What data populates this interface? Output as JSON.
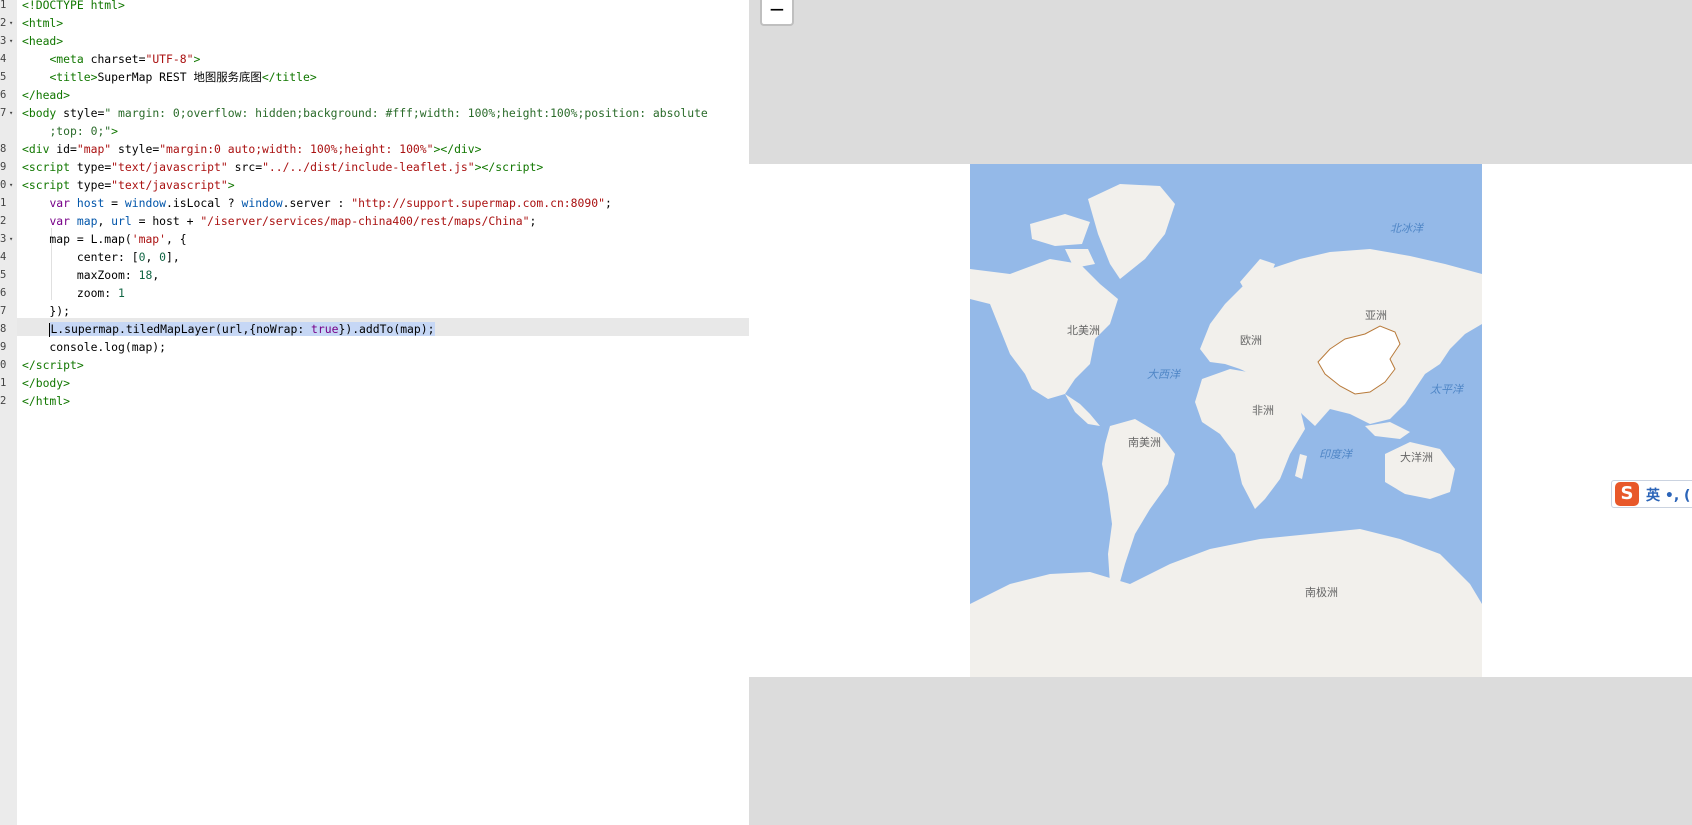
{
  "editor": {
    "lines": [
      {
        "n": "1",
        "fold": "",
        "html": "<span class='tg'>&lt;!DOCTYPE html&gt;</span>"
      },
      {
        "n": "2",
        "fold": "▾",
        "html": "<span class='tg'>&lt;html&gt;</span>"
      },
      {
        "n": "3",
        "fold": "▾",
        "html": "<span class='tg'>&lt;head&gt;</span>"
      },
      {
        "n": "4",
        "fold": "",
        "html": "    <span class='tg'>&lt;meta</span> <span class='at'>charset</span>=<span class='st'>\"UTF-8\"</span><span class='tg'>&gt;</span>"
      },
      {
        "n": "5",
        "fold": "",
        "html": "    <span class='tg'>&lt;title&gt;</span>SuperMap REST 地图服务底图<span class='tg'>&lt;/title&gt;</span>"
      },
      {
        "n": "6",
        "fold": "",
        "html": "<span class='tg'>&lt;/head&gt;</span>"
      },
      {
        "n": "7",
        "fold": "▾",
        "html": "<span class='tg'>&lt;body</span> <span class='at'>style</span>=<span class='gr'>\" margin: 0;overflow: hidden;background: #fff;width: 100%;height:100%;position: absolute</span>"
      },
      {
        "n": "",
        "fold": "",
        "html": "    <span class='gr'>;top: 0;\"</span><span class='tg'>&gt;</span>"
      },
      {
        "n": "8",
        "fold": "",
        "html": "<span class='tg'>&lt;div</span> <span class='at'>id</span>=<span class='st'>\"map\"</span> <span class='at'>style</span>=<span class='st'>\"margin:0 auto;width: 100%;height: 100%\"</span><span class='tg'>&gt;&lt;/div&gt;</span>"
      },
      {
        "n": "9",
        "fold": "",
        "html": "<span class='tg'>&lt;script</span> <span class='at'>type</span>=<span class='st'>\"text/javascript\"</span> <span class='at'>src</span>=<span class='st'>\"../../dist/include-leaflet.js\"</span><span class='tg'>&gt;&lt;/script&gt;</span>"
      },
      {
        "n": "0",
        "fold": "▾",
        "html": "<span class='tg'>&lt;script</span> <span class='at'>type</span>=<span class='st'>\"text/javascript\"</span><span class='tg'>&gt;</span>"
      },
      {
        "n": "1",
        "fold": "",
        "html": "    <span class='kw'>var</span> <span class='vr'>host</span> = <span class='vr'>window</span>.isLocal ? <span class='vr'>window</span>.server : <span class='st'>\"http://support.supermap.com.cn:8090\"</span>;"
      },
      {
        "n": "2",
        "fold": "",
        "html": "    <span class='kw'>var</span> <span class='vr'>map</span>, <span class='vr'>url</span> = host + <span class='st'>\"/iserver/services/map-china400/rest/maps/China\"</span>;"
      },
      {
        "n": "3",
        "fold": "▾",
        "html": "    map = L.map(<span class='st'>'map'</span>, {"
      },
      {
        "n": "4",
        "fold": "",
        "html": "        center: [<span class='nm'>0</span>, <span class='nm'>0</span>],"
      },
      {
        "n": "5",
        "fold": "",
        "html": "        maxZoom: <span class='nm'>18</span>,"
      },
      {
        "n": "6",
        "fold": "",
        "html": "        zoom: <span class='nm'>1</span>"
      },
      {
        "n": "7",
        "fold": "",
        "html": "    });"
      },
      {
        "n": "8",
        "fold": "",
        "html": "    <span class='cursor'></span><span class='sel'>L.supermap.tiledMapLayer(url,{noWrap: <span class='kw'>true</span>}).addTo(map);</span>"
      },
      {
        "n": "9",
        "fold": "",
        "html": "    console.log(map);"
      },
      {
        "n": "0",
        "fold": "",
        "html": "<span class='tg'>&lt;/script&gt;</span>"
      },
      {
        "n": "1",
        "fold": "",
        "html": "<span class='tg'>&lt;/body&gt;</span>"
      },
      {
        "n": "2",
        "fold": "",
        "html": "<span class='tg'>&lt;/html&gt;</span>"
      }
    ]
  },
  "preview": {
    "zoom_out_label": "−",
    "map_labels": {
      "north_america": "北美洲",
      "south_america": "南美洲",
      "europe": "欧洲",
      "asia": "亚洲",
      "africa": "非洲",
      "oceania": "大洋洲",
      "antarctica": "南极洲",
      "atlantic": "大西洋",
      "pacific": "太平洋",
      "indian": "印度洋",
      "arctic": "北冰洋"
    },
    "ime_logo": "S",
    "ime_text": "英 •, ("
  },
  "colors": {
    "ocean": "#94b9e8",
    "land": "#f2f0ec",
    "china_border": "#b87a3a"
  }
}
